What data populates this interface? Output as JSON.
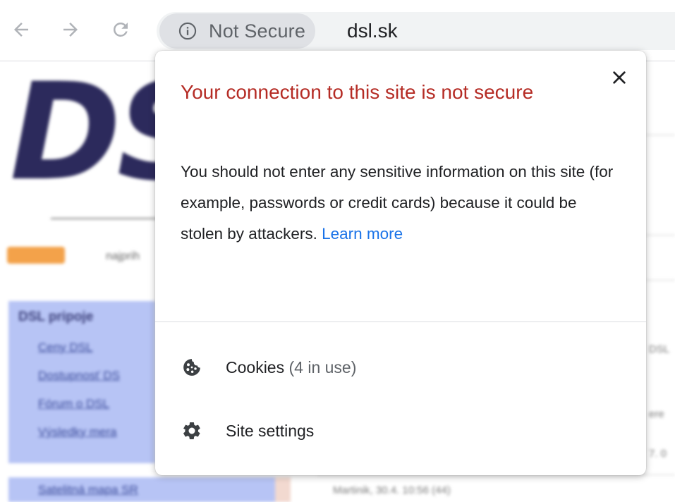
{
  "browser": {
    "security_chip_label": "Not Secure",
    "url": "dsl.sk",
    "icons": {
      "back": "arrow-left-icon",
      "forward": "arrow-right-icon",
      "reload": "reload-icon",
      "info": "info-circle-icon"
    }
  },
  "page_behind": {
    "logo": "DS",
    "side_box_title": "DSL pripoje",
    "side_links": [
      "Ceny DSL",
      "Dostupnosť DS",
      "Fórum o DSL",
      "Výsledky mera"
    ],
    "side_box_2_text": "Satelitná mapa SR",
    "nav_snippet": "najprih",
    "right_snippets": [
      "DSL",
      "ere",
      "7. 0",
      "Martinik, 30.4. 10:56 (44)"
    ]
  },
  "popup": {
    "title": "Your connection to this site is not secure",
    "body": "You should not enter any sensitive information on this site (for example, passwords or credit cards) because it could be stolen by attackers.",
    "learn_more_label": "Learn more",
    "close_icon": "close-icon",
    "cookies": {
      "label": "Cookies",
      "count": "(4 in use)",
      "icon": "cookie-icon"
    },
    "site_settings": {
      "label": "Site settings",
      "icon": "gear-icon"
    }
  },
  "colors": {
    "title_red": "#b52c25",
    "link_blue": "#1a73e8",
    "chip_bg": "#dfe1e5",
    "omnibox_bg": "#f1f3f4"
  }
}
